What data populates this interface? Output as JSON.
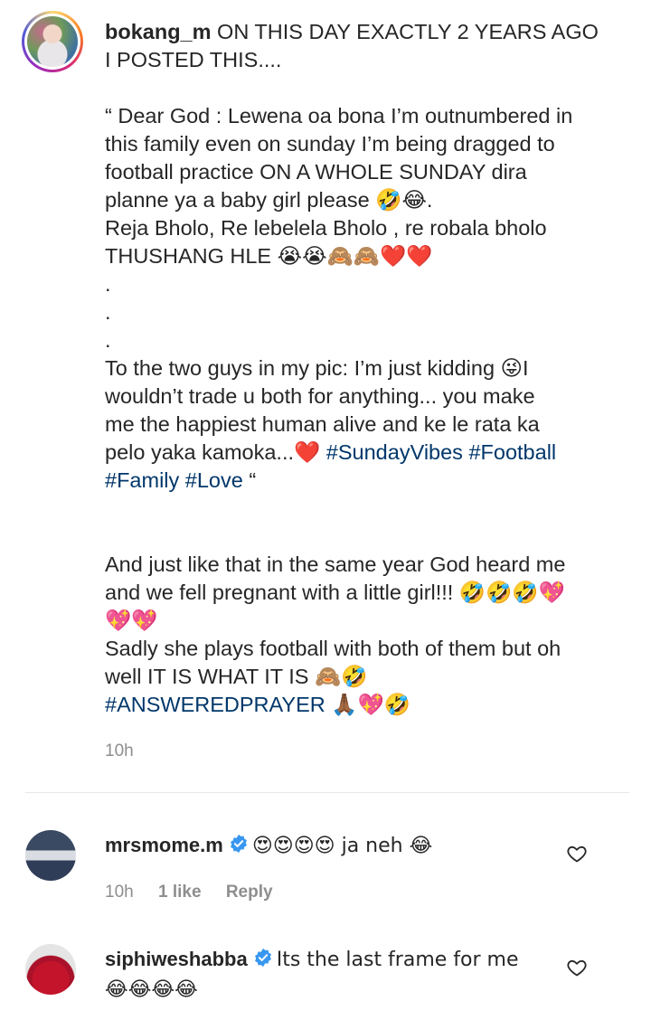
{
  "post": {
    "username": "bokang_m",
    "caption": " ON THIS DAY EXACTLY 2 YEARS AGO\nI POSTED THIS....\n\n“ Dear God : Lewena oa bona I’m outnumbered in\nthis family even on sunday I’m being dragged to\nfootball practice ON A WHOLE SUNDAY dira\nplanne ya a baby girl please 🤣😂.\nReja Bholo, Re lebelela Bholo , re robala bholo\nTHUSHANG HLE 😭😭🙈🙈❤️❤️\n.\n.\n.\nTo the two guys in my pic: I’m just kidding 😜I\nwouldn’t trade u both for anything... you make\nme the happiest human alive and ke le rata ka\npelo yaka kamoka...❤️ ",
    "tags1": "#SundayVibes #Football\n#Family #Love",
    "caption_tail1": " “\n\n\nAnd just like that in the same year God heard me\nand we fell pregnant with a little girl!!! 🤣🤣🤣💖\n💖💖\nSadly she plays football with both of them but oh\nwell IT IS WHAT IT IS 🙈🤣\n",
    "tags2": "#ANSWEREDPRAYER",
    "caption_tail2": " 🙏🏾💖🤣",
    "time": "10h"
  },
  "comments": [
    {
      "username": "mrsmome.m",
      "text": "😍😍😍😍 ja neh 😂",
      "time": "10h",
      "likes": "1 like",
      "reply": "Reply"
    },
    {
      "username": "siphiweshabba",
      "text": "Its the last frame for me\n😂😂😂😂"
    }
  ],
  "icons": {
    "verified": "verified-badge-icon",
    "like": "heart-outline-icon"
  },
  "colors": {
    "hashtag": "#00376b",
    "verified": "#3897f0",
    "muted": "#8e8e8e"
  }
}
